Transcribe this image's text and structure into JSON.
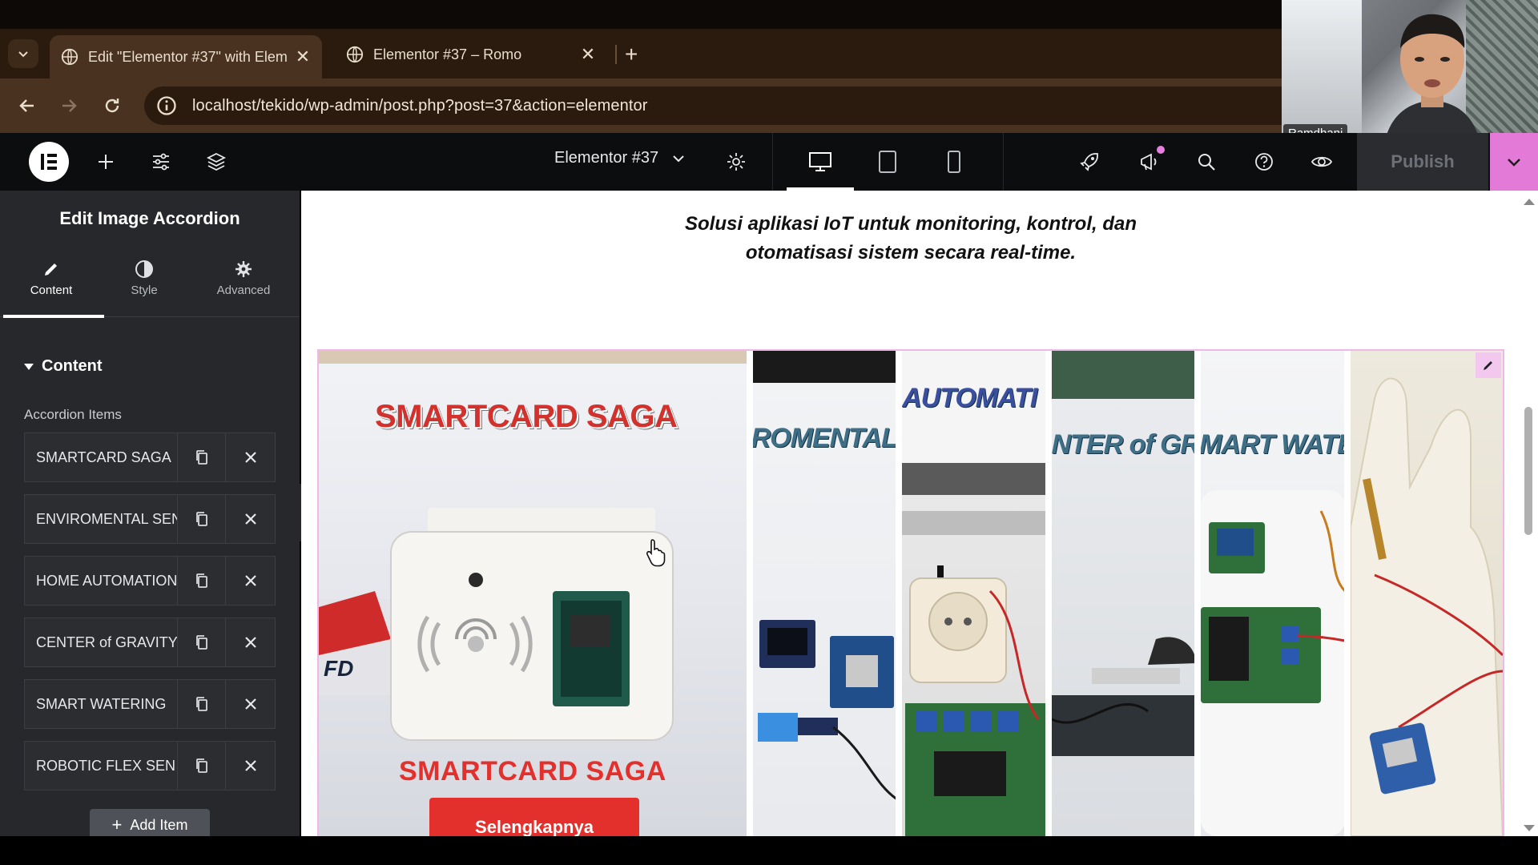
{
  "browser": {
    "tabs": [
      {
        "title": "Edit \"Elementor #37\" with Elem",
        "active": true
      },
      {
        "title": "Elementor #37 – Romo",
        "active": false
      }
    ],
    "url": "localhost/tekido/wp-admin/post.php?post=37&action=elementor"
  },
  "webcam": {
    "name": "Ramdhani"
  },
  "elementor": {
    "document_title": "Elementor #37",
    "publish_label": "Publish",
    "colors": {
      "accent": "#e37ad8",
      "panel_bg": "#26282b",
      "bar_bg": "#0c0d0e"
    }
  },
  "panel": {
    "heading": "Edit Image Accordion",
    "tabs": [
      {
        "label": "Content",
        "icon": "pencil-icon"
      },
      {
        "label": "Style",
        "icon": "contrast-icon"
      },
      {
        "label": "Advanced",
        "icon": "gear-icon"
      }
    ],
    "section_title": "Content",
    "repeater_label": "Accordion Items",
    "items": [
      {
        "label": "SMARTCARD SAGA"
      },
      {
        "label": "ENVIROMENTAL SEN"
      },
      {
        "label": "HOME AUTOMATION"
      },
      {
        "label": "CENTER of GRAVITY"
      },
      {
        "label": "SMART WATERING"
      },
      {
        "label": "ROBOTIC FLEX SEN"
      }
    ],
    "add_item_label": "Add Item"
  },
  "canvas": {
    "tagline_line1": "Solusi aplikasi IoT untuk monitoring, kontrol, dan",
    "tagline_line2": "otomatisasi sistem secara real-time.",
    "accordion": {
      "active_title": "SMARTCARD SAGA",
      "active_title_bottom": "SMARTCARD SAGA",
      "cta_label": "Selengkapnya",
      "strips": [
        {
          "label": "ROMENTAL S"
        },
        {
          "label": "AUTOMATI"
        },
        {
          "label": "NTER of GR"
        },
        {
          "label": "MART WATEI"
        },
        {
          "label": ""
        }
      ]
    }
  }
}
